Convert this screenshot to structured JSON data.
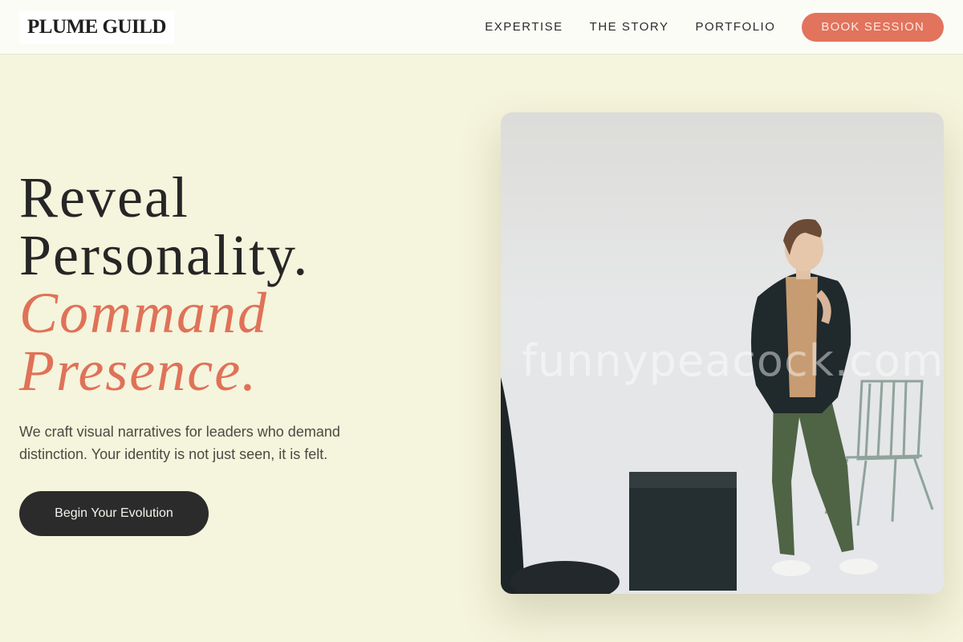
{
  "header": {
    "logo": "PLUME GUILD",
    "nav": [
      "EXPERTISE",
      "THE STORY",
      "PORTFOLIO"
    ],
    "cta_label": "BOOK SESSION"
  },
  "hero": {
    "title_line1": "Reveal",
    "title_line2": "Personality.",
    "title_line3": "Command",
    "title_line4": "Presence.",
    "subtitle": "We craft visual narratives for leaders who demand distinction. Your identity is not just seen, it is felt.",
    "cta_label": "Begin Your Evolution"
  },
  "photo": {
    "watermark": "funnypeacock.com"
  },
  "colors": {
    "background": "#f5f4dc",
    "accent": "#e2735c",
    "dark": "#2b2b2b"
  }
}
